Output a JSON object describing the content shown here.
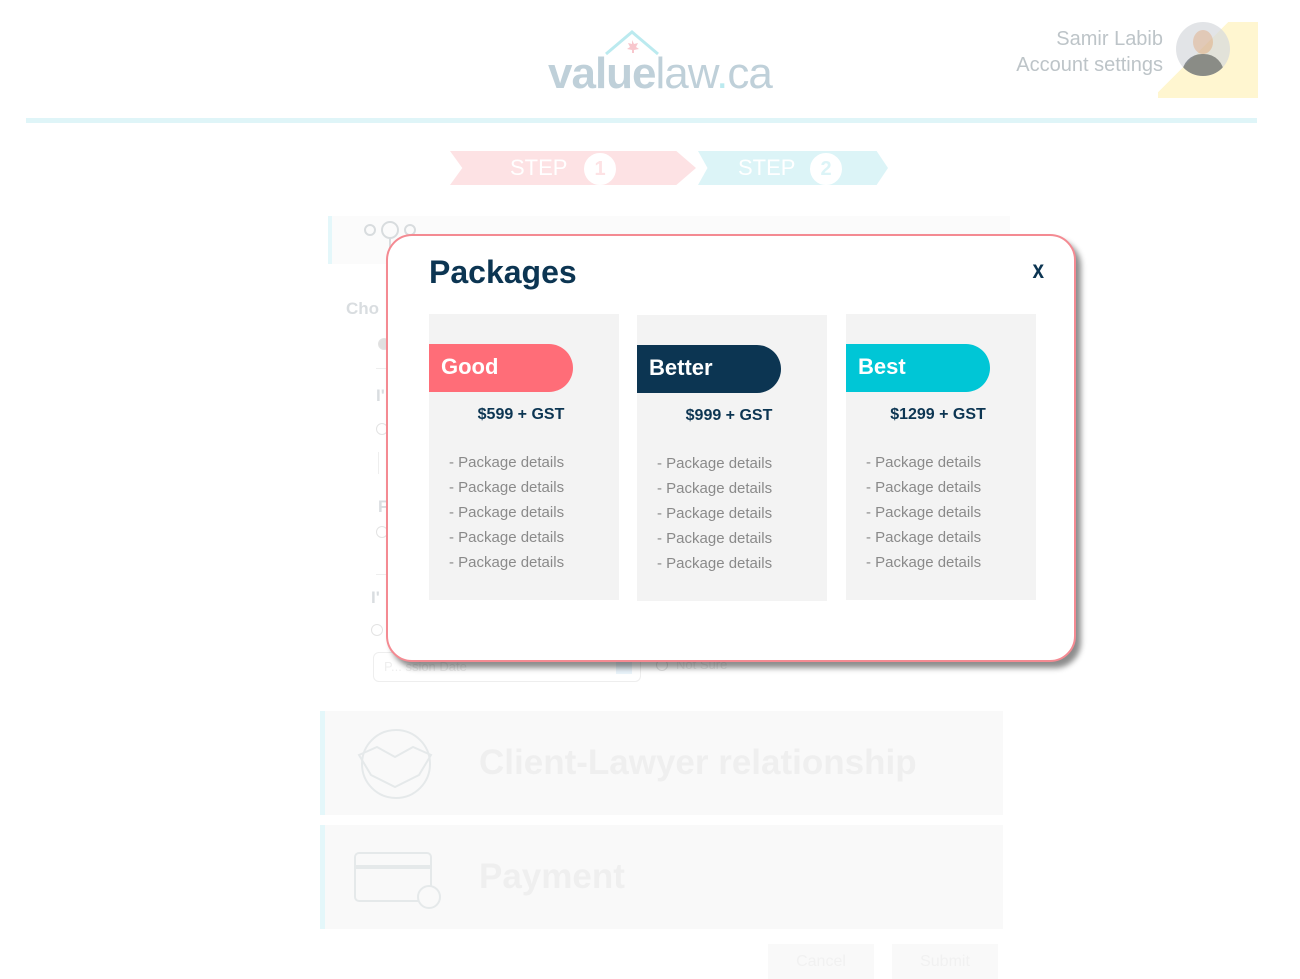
{
  "header": {
    "logo": {
      "part1": "value",
      "part2": "law",
      "dot": ".",
      "tld": "ca"
    },
    "user_name": "Samir Labib",
    "account_link": "Account settings"
  },
  "steps": [
    {
      "label": "STEP",
      "number": "1"
    },
    {
      "label": "STEP",
      "number": "2"
    }
  ],
  "background": {
    "choose_label": "Cho",
    "section1_char": "I'",
    "section2_char": "F",
    "section3_char": "I'",
    "date_placeholder": "P... ssion Date",
    "not_sure": "Not Sure",
    "sections": [
      "Client-Lawyer relationship",
      "Payment"
    ],
    "buttons": [
      "Cancel",
      "Submit"
    ]
  },
  "modal": {
    "title": "Packages",
    "close_label": "x",
    "packages": [
      {
        "name": "Good",
        "price": "$599 + GST",
        "color": "#ff6d78",
        "details": [
          "- Package details",
          "- Package details",
          "- Package details",
          "- Package details",
          "- Package details"
        ]
      },
      {
        "name": "Better",
        "price": "$999 + GST",
        "color": "#0c3552",
        "details": [
          "- Package details",
          "- Package details",
          "- Package details",
          "- Package details",
          "- Package details"
        ]
      },
      {
        "name": "Best",
        "price": "$1299 + GST",
        "color": "#00c6d6",
        "details": [
          "- Package details",
          "- Package details",
          "- Package details",
          "- Package details",
          "- Package details"
        ]
      }
    ]
  },
  "colors": {
    "accent_pink": "#f48a92",
    "navy": "#0c3552",
    "teal": "#00c6d6"
  }
}
